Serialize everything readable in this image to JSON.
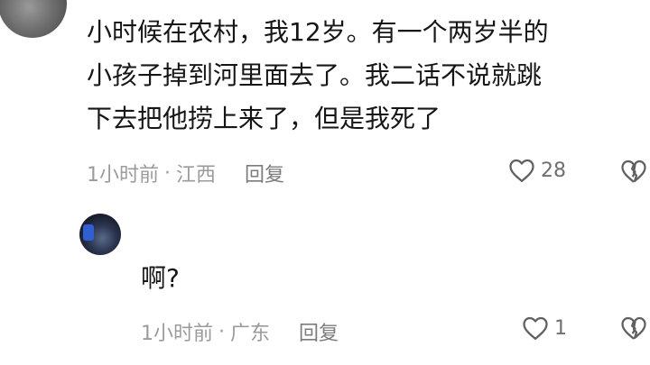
{
  "comment": {
    "lines": [
      "小时候在农村，我12岁。有一个两岁半的",
      "小孩子掉到河里面去了。我二话不说就跳",
      "下去把他捞上来了，但是我死了"
    ],
    "time": "1小时前",
    "separator": "·",
    "location": "江西",
    "reply_label": "回复",
    "like_count": "28"
  },
  "reply": {
    "text": "啊?",
    "time": "1小时前",
    "separator": "·",
    "location": "广东",
    "reply_label": "回复",
    "like_count": "1"
  },
  "icons": {
    "like": "heart-outline-icon",
    "dislike": "broken-heart-icon"
  },
  "colors": {
    "text": "#161616",
    "meta": "#9b9b9b",
    "icon": "#6f6f6f"
  }
}
